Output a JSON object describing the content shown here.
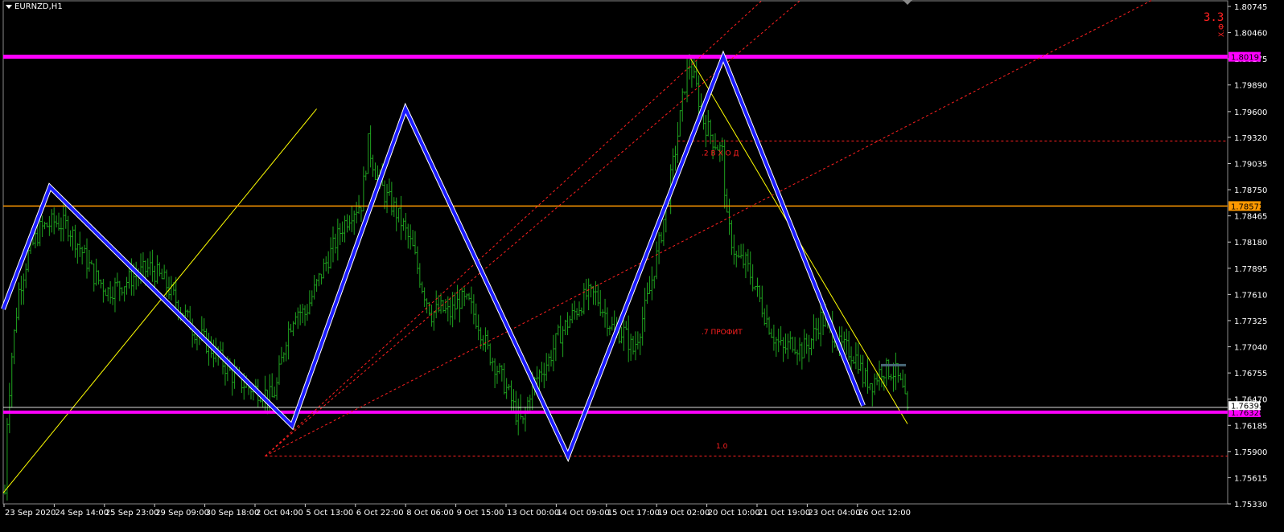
{
  "window": {
    "symbol_label": "EURNZD,H1"
  },
  "colors": {
    "background": "#000000",
    "grid": "#1c1c1c",
    "axis_text": "#ffffff",
    "price_bars": "#1fa31f",
    "zigzag": "#1b1bff",
    "zigzag_outline": "#ffffff",
    "support_resistance": "#ff00ff",
    "orange_level": "#ff9900",
    "fib_lines": "#ff2020",
    "trend_lines": "#ffff00"
  },
  "chart_data": {
    "type": "bar",
    "symbol": "EURNZD",
    "timeframe": "H1",
    "ylim": [
      1.7533,
      1.80745
    ],
    "y_ticks": [
      "1.80745",
      "1.80460",
      "1.80175",
      "1.79890",
      "1.79600",
      "1.79320",
      "1.79035",
      "1.78750",
      "1.78465",
      "1.78180",
      "1.77895",
      "1.77610",
      "1.77325",
      "1.77040",
      "1.76755",
      "1.76470",
      "1.76185",
      "1.75900",
      "1.75615",
      "1.75330"
    ],
    "x_tick_labels": [
      "23 Sep 2020",
      "24 Sep 14:00",
      "25 Sep 23:00",
      "29 Sep 09:00",
      "30 Sep 18:00",
      "2 Oct 04:00",
      "5 Oct 13:00",
      "6 Oct 22:00",
      "8 Oct 06:00",
      "9 Oct 15:00",
      "13 Oct 00:00",
      "14 Oct 09:00",
      "15 Oct 17:00",
      "19 Oct 02:00",
      "20 Oct 10:00",
      "21 Oct 19:00",
      "23 Oct 04:00",
      "26 Oct 12:00"
    ],
    "price_anchors": [
      [
        0,
        1.7545
      ],
      [
        1,
        1.7625
      ],
      [
        3,
        1.7695
      ],
      [
        6,
        1.7765
      ],
      [
        10,
        1.7805
      ],
      [
        15,
        1.7832
      ],
      [
        21,
        1.784
      ],
      [
        27,
        1.7835
      ],
      [
        32,
        1.7812
      ],
      [
        38,
        1.7782
      ],
      [
        44,
        1.7765
      ],
      [
        50,
        1.7772
      ],
      [
        56,
        1.7782
      ],
      [
        62,
        1.779
      ],
      [
        68,
        1.7775
      ],
      [
        74,
        1.775
      ],
      [
        80,
        1.7725
      ],
      [
        86,
        1.7708
      ],
      [
        92,
        1.769
      ],
      [
        98,
        1.767
      ],
      [
        104,
        1.766
      ],
      [
        110,
        1.7655
      ],
      [
        114,
        1.7648
      ],
      [
        116,
        1.7662
      ],
      [
        120,
        1.7715
      ],
      [
        124,
        1.7745
      ],
      [
        128,
        1.774
      ],
      [
        132,
        1.7765
      ],
      [
        136,
        1.779
      ],
      [
        140,
        1.7812
      ],
      [
        144,
        1.7835
      ],
      [
        148,
        1.7852
      ],
      [
        152,
        1.786
      ],
      [
        155,
        1.7925
      ],
      [
        158,
        1.7895
      ],
      [
        162,
        1.787
      ],
      [
        166,
        1.7855
      ],
      [
        170,
        1.7835
      ],
      [
        174,
        1.781
      ],
      [
        178,
        1.777
      ],
      [
        182,
        1.774
      ],
      [
        186,
        1.7745
      ],
      [
        190,
        1.774
      ],
      [
        194,
        1.7755
      ],
      [
        198,
        1.775
      ],
      [
        202,
        1.773
      ],
      [
        206,
        1.77
      ],
      [
        210,
        1.768
      ],
      [
        214,
        1.7658
      ],
      [
        218,
        1.7632
      ],
      [
        221,
        1.762
      ],
      [
        224,
        1.7655
      ],
      [
        228,
        1.7675
      ],
      [
        232,
        1.769
      ],
      [
        236,
        1.7715
      ],
      [
        240,
        1.773
      ],
      [
        244,
        1.7745
      ],
      [
        248,
        1.776
      ],
      [
        252,
        1.776
      ],
      [
        256,
        1.774
      ],
      [
        260,
        1.772
      ],
      [
        264,
        1.772
      ],
      [
        268,
        1.77
      ],
      [
        271,
        1.7725
      ],
      [
        275,
        1.7765
      ],
      [
        279,
        1.7815
      ],
      [
        283,
        1.787
      ],
      [
        287,
        1.7935
      ],
      [
        290,
        1.799
      ],
      [
        292,
        1.8012
      ],
      [
        295,
        1.7985
      ],
      [
        298,
        1.795
      ],
      [
        302,
        1.793
      ],
      [
        306,
        1.7915
      ],
      [
        308,
        1.784
      ],
      [
        312,
        1.78
      ],
      [
        316,
        1.7795
      ],
      [
        320,
        1.777
      ],
      [
        324,
        1.774
      ],
      [
        328,
        1.7715
      ],
      [
        332,
        1.77
      ],
      [
        336,
        1.771
      ],
      [
        340,
        1.77
      ],
      [
        344,
        1.7712
      ],
      [
        348,
        1.7735
      ],
      [
        352,
        1.7725
      ],
      [
        356,
        1.7705
      ],
      [
        360,
        1.77
      ],
      [
        364,
        1.769
      ],
      [
        366,
        1.767
      ],
      [
        370,
        1.7665
      ],
      [
        374,
        1.768
      ],
      [
        378,
        1.7678
      ],
      [
        380,
        1.7675
      ],
      [
        383,
        1.7655
      ],
      [
        385,
        1.763
      ]
    ],
    "total_bars": 386,
    "levels": [
      {
        "price": 1.80197,
        "label": "1.80197",
        "role": "resistance"
      },
      {
        "price": 1.78572,
        "label": "1.78572",
        "role": "orange"
      },
      {
        "price": 1.76328,
        "label": "1.76328",
        "role": "support"
      }
    ],
    "fib_annotations": [
      {
        "text": ".2 В Х О Д",
        "price": 1.7915
      },
      {
        "text": ".7 ПРОФИТ",
        "price": 1.772
      },
      {
        "text": "1.0",
        "price": 1.7596
      }
    ],
    "fib_level_prices": [
      1.7928,
      1.7585
    ],
    "current_price_label": "1.76395",
    "corner_text": "3.3",
    "corner_subtext": "Х.Ф"
  }
}
